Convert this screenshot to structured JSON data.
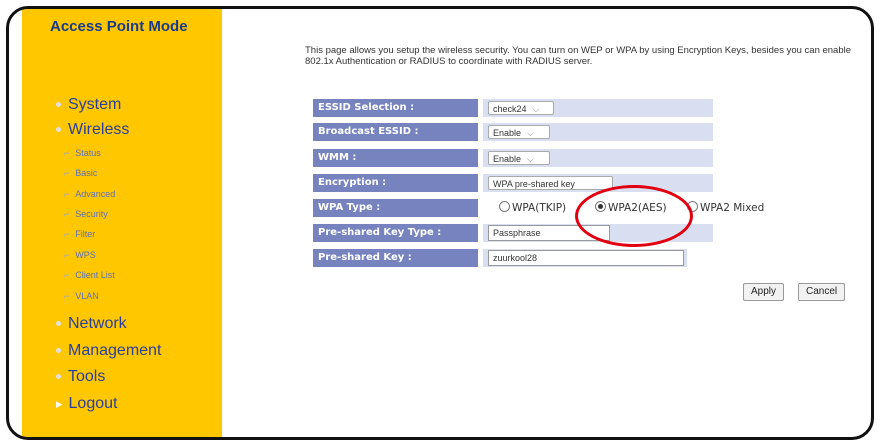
{
  "sidebar": {
    "title": "Access Point Mode",
    "main_items": [
      {
        "label": "System",
        "marker": "•"
      },
      {
        "label": "Wireless",
        "marker": "•"
      },
      {
        "label": "Network",
        "marker": "•"
      },
      {
        "label": "Management",
        "marker": "•"
      },
      {
        "label": "Tools",
        "marker": "•"
      },
      {
        "label": "Logout",
        "marker": "▸"
      }
    ],
    "sub_items": [
      "Status",
      "Basic",
      "Advanced",
      "Security",
      "Filter",
      "WPS",
      "Client List",
      "VLAN"
    ]
  },
  "intro_text": "This page allows you setup the wireless security. You can turn on WEP or WPA by using Encryption Keys, besides you can enable 802.1x Authentication or RADIUS to coordinate with RADIUS server.",
  "form": {
    "essid_label": "ESSID Selection :",
    "essid_value": "check24",
    "broadcast_label": "Broadcast ESSID :",
    "broadcast_value": "Enable",
    "wmm_label": "WMM :",
    "wmm_value": "Enable",
    "encryption_label": "Encryption :",
    "encryption_value": "WPA pre-shared key",
    "wpa_type_label": "WPA Type :",
    "wpa_options": [
      "WPA(TKIP)",
      "WPA2(AES)",
      "WPA2 Mixed"
    ],
    "wpa_selected": "WPA2(AES)",
    "psk_type_label": "Pre-shared Key Type :",
    "psk_type_value": "Passphrase",
    "psk_label": "Pre-shared Key :",
    "psk_value": "zuurkool28"
  },
  "buttons": {
    "apply": "Apply",
    "cancel": "Cancel"
  },
  "colors": {
    "sidebar": "#ffc700",
    "label_bg": "#7683bf",
    "annotation": "#e10010"
  }
}
